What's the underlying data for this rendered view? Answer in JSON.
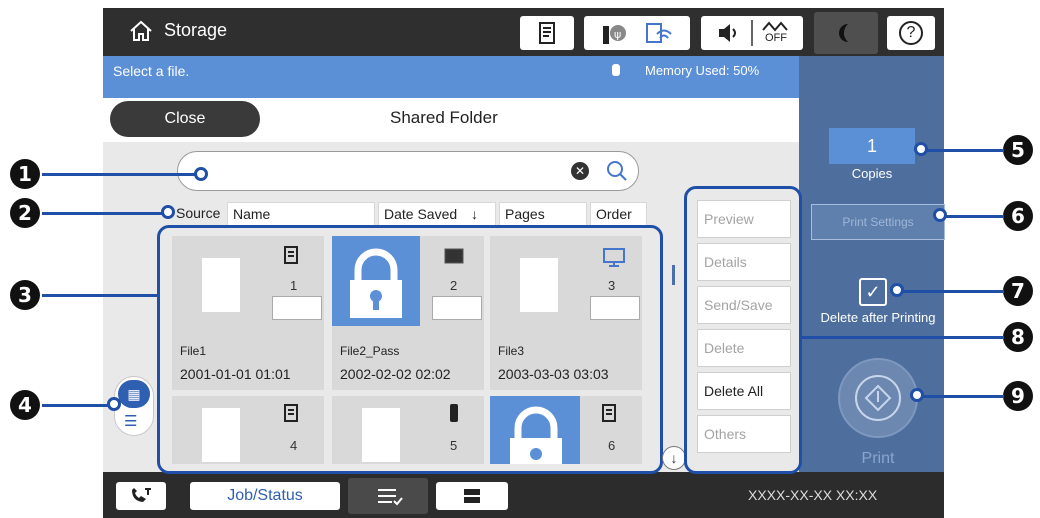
{
  "colors": {
    "topbar": "#2f2f2f",
    "status": "#5b8fd6",
    "right_panel": "#4e6f9e",
    "callout_blue": "#1f4fa6"
  },
  "header": {
    "app_title": "Storage",
    "icons": [
      "home-icon",
      "paper-setting-icon",
      "ink-icon",
      "wifi-icon",
      "volume-icon",
      "quiet-off-icon",
      "night-mode-icon",
      "help-icon"
    ],
    "quiet_off_label": "OFF",
    "help_glyph": "?"
  },
  "status": {
    "message": "Select a file.",
    "memory": "Memory Used: 50%"
  },
  "folder": {
    "close_label": "Close",
    "title": "Shared Folder"
  },
  "columns": {
    "source": "Source",
    "name": "Name",
    "date_saved": "Date Saved",
    "pages": "Pages",
    "order": "Order"
  },
  "files": [
    {
      "name": "File1",
      "date": "2001-01-01 01:01",
      "page": "1",
      "locked": false
    },
    {
      "name": "File2_Pass",
      "date": "2002-02-02 02:02",
      "page": "2",
      "locked": true
    },
    {
      "name": "File3",
      "date": "2003-03-03 03:03",
      "page": "3",
      "locked": false
    },
    {
      "name": "",
      "date": "",
      "page": "4",
      "locked": false
    },
    {
      "name": "",
      "date": "",
      "page": "5",
      "locked": false
    },
    {
      "name": "",
      "date": "",
      "page": "6",
      "locked": true
    }
  ],
  "actions": {
    "preview": "Preview",
    "details": "Details",
    "send_save": "Send/Save",
    "delete": "Delete",
    "delete_all": "Delete All",
    "others": "Others"
  },
  "right": {
    "copies_value": "1",
    "copies_label": "Copies",
    "print_settings": "Print Settings",
    "delete_after": "Delete after Printing",
    "print": "Print"
  },
  "bottom": {
    "job_status": "Job/Status",
    "datetime": "XXXX-XX-XX  XX:XX"
  },
  "callouts": [
    "1",
    "2",
    "3",
    "4",
    "5",
    "6",
    "7",
    "8",
    "9"
  ]
}
